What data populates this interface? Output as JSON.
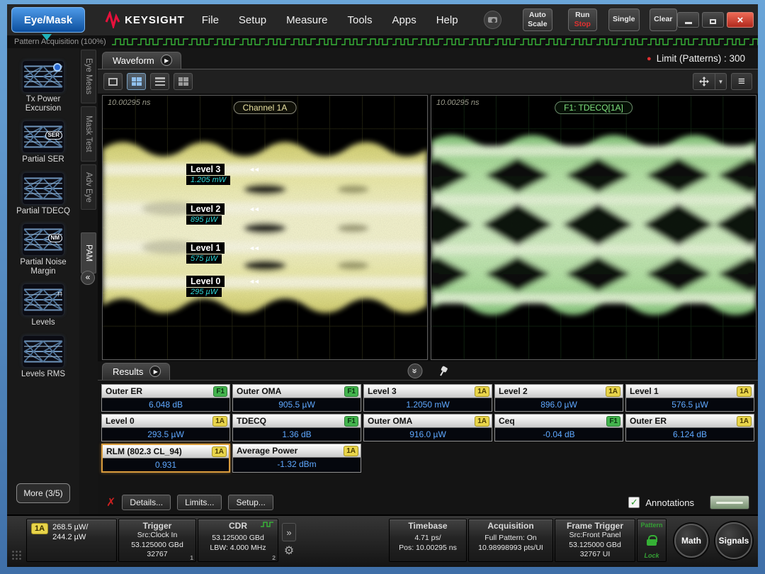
{
  "glyphs": {
    "play": "▶",
    "collapse": "«",
    "double_chevron": "»",
    "close": "×",
    "check": "✓",
    "fail": "✗",
    "gear": "⚙",
    "dropdown": "▼",
    "dot": "●",
    "marker": "◄◄",
    "hamburger": "≡",
    "arrows_up": "↑↑"
  },
  "topbar": {
    "app_tab": "Eye/Mask",
    "brand": "KEYSIGHT",
    "menus": [
      {
        "label": "File"
      },
      {
        "label": "Setup"
      },
      {
        "label": "Measure"
      },
      {
        "label": "Tools"
      },
      {
        "label": "Apps"
      },
      {
        "label": "Help"
      }
    ],
    "auto_scale_line1": "Auto",
    "auto_scale_line2": "Scale",
    "run_label": "Run",
    "stop_label": "Stop",
    "single_label": "Single",
    "clear_label": "Clear"
  },
  "acq": {
    "label": "Pattern Acquisition  (100%)"
  },
  "sidebar": {
    "items": [
      {
        "label": "Tx Power Excursion",
        "badge": ""
      },
      {
        "label": "Partial SER",
        "badge": "SER"
      },
      {
        "label": "Partial TDECQ",
        "badge": ""
      },
      {
        "label": "Partial Noise Margin",
        "badge": "NM"
      },
      {
        "label": "Levels",
        "badge": ""
      },
      {
        "label": "Levels RMS",
        "badge": ""
      }
    ],
    "more": "More (3/5)"
  },
  "vtabs": {
    "t0": "Eye Meas",
    "t1": "Mask Test",
    "t2": "Adv Eye",
    "t3": "PAM"
  },
  "wave": {
    "tab": "Waveform",
    "limit": "Limit (Patterns) : 300"
  },
  "eyes": {
    "left": {
      "timebase": "10.00295 ns",
      "title": "Channel 1A",
      "levels": [
        {
          "name": "Level 3",
          "value": "1.205 mW"
        },
        {
          "name": "Level 2",
          "value": "895 µW"
        },
        {
          "name": "Level 1",
          "value": "575 µW"
        },
        {
          "name": "Level 0",
          "value": "295 µW"
        }
      ]
    },
    "right": {
      "timebase": "10.00295 ns",
      "title": "F1: TDECQ[1A]"
    }
  },
  "results": {
    "tab": "Results",
    "cells": [
      {
        "name": "Outer ER",
        "badge": "F1",
        "value": "6.048 dB"
      },
      {
        "name": "Outer OMA",
        "badge": "F1",
        "value": "905.5 µW"
      },
      {
        "name": "Level 3",
        "badge": "1A",
        "value": "1.2050 mW"
      },
      {
        "name": "Level 2",
        "badge": "1A",
        "value": "896.0 µW"
      },
      {
        "name": "Level 1",
        "badge": "1A",
        "value": "576.5 µW"
      },
      {
        "name": "Level 0",
        "badge": "1A",
        "value": "293.5 µW"
      },
      {
        "name": "TDECQ",
        "badge": "F1",
        "value": "1.36 dB"
      },
      {
        "name": "Outer OMA",
        "badge": "1A",
        "value": "916.0 µW"
      },
      {
        "name": "Ceq",
        "badge": "F1",
        "value": "-0.04 dB"
      },
      {
        "name": "Outer ER",
        "badge": "1A",
        "value": "6.124 dB"
      },
      {
        "name": "RLM (802.3 CL_94)",
        "badge": "1A",
        "value": "0.931"
      },
      {
        "name": "Average Power",
        "badge": "1A",
        "value": "-1.32 dBm"
      }
    ],
    "details": "Details...",
    "limits": "Limits...",
    "setup": "Setup...",
    "annotations": "Annotations"
  },
  "status": {
    "channel": {
      "badge": "1A",
      "line1": "268.5 µW/",
      "line2": "244.2 µW"
    },
    "trigger": {
      "title": "Trigger",
      "l1": "Src:Clock In",
      "l2": "53.125000 GBd",
      "l3": "32767",
      "corner": "1"
    },
    "cdr": {
      "title": "CDR",
      "l1": "53.125000 GBd",
      "l2": "LBW: 4.000 MHz",
      "corner": "2"
    },
    "timebase": {
      "title": "Timebase",
      "l1": "4.71 ps/",
      "l2": "Pos: 10.00295 ns"
    },
    "acquisition": {
      "title": "Acquisition",
      "l1": "Full Pattern: On",
      "l2": "10.98998993 pts/UI"
    },
    "frame": {
      "title": "Frame Trigger",
      "l1": "Src:Front Panel",
      "l2": "53.125000 GBd",
      "l3": "32767 UI"
    },
    "pattern_lock": {
      "top": "Pattern",
      "bottom": "Lock"
    },
    "math": "Math",
    "signals": "Signals"
  }
}
